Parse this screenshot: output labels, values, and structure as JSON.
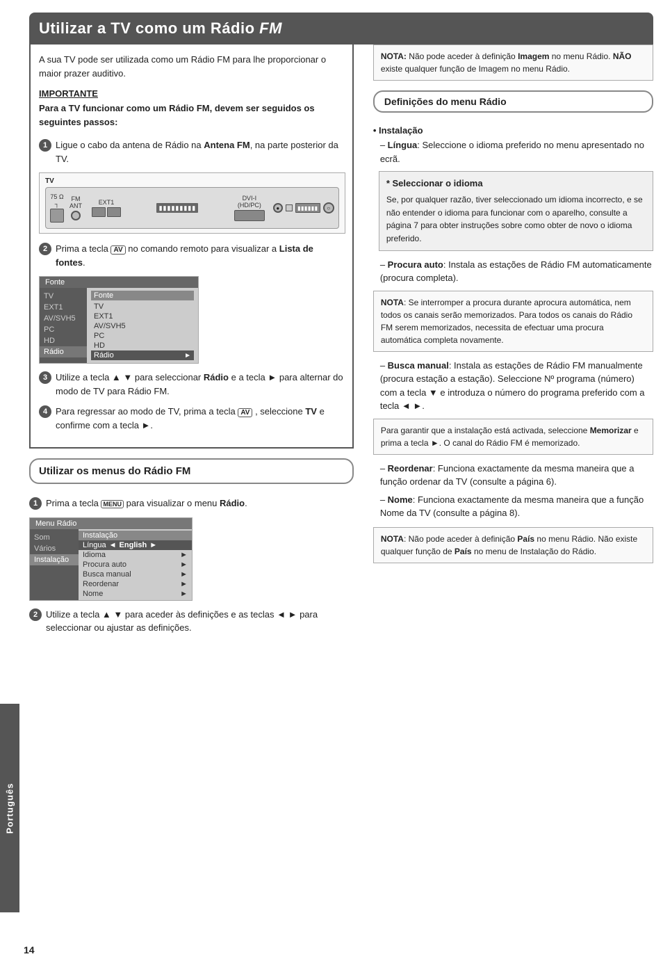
{
  "page": {
    "number": "14",
    "sidebar_label": "Português"
  },
  "title": {
    "prefix": "Utilizar a TV como um Rádio ",
    "highlight": "FM"
  },
  "intro": "A sua TV pode ser utilizada como um Rádio FM para lhe proporcionar o maior prazer auditivo.",
  "importante": {
    "label": "IMPORTANTE",
    "body": "Para a TV funcionar como um Rádio FM, devem ser seguidos os seguintes passos:"
  },
  "steps_left": [
    {
      "number": "1",
      "text": "Ligue o cabo da antena de Rádio na ",
      "bold": "Antena FM",
      "suffix": ", na parte posterior da TV."
    },
    {
      "number": "2",
      "text": "Prima a tecla ",
      "av_symbol": "AV",
      "suffix": " no comando remoto para visualizar a ",
      "bold2": "Lista de fontes",
      "end": "."
    },
    {
      "number": "3",
      "text": "Utilize a tecla ▲ ▼ para seleccionar ",
      "bold": "Rádio",
      "suffix": " e a tecla ► para alternar do modo de TV para Rádio FM."
    },
    {
      "number": "4",
      "text": "Para regressar ao modo de TV, prima a tecla ",
      "av_symbol": "AV",
      "suffix": " , seleccione ",
      "bold2": "TV",
      "end": " e confirme com a tecla ►."
    }
  ],
  "tv_diagram": {
    "label": "TV",
    "ports": [
      {
        "label": "75 Ω\n┐",
        "type": "square_small"
      },
      {
        "label": "FM\nANT",
        "type": "circle"
      },
      {
        "label": "EXT1\n⬜⬜",
        "type": "square"
      },
      {
        "label": "DVI-I\n(HD/PC)",
        "type": "wide"
      }
    ]
  },
  "source_menu": {
    "header": "Fonte",
    "left_items": [
      "TV",
      "EXT1",
      "AV/SVH5",
      "PC",
      "HD",
      "Rádio"
    ],
    "right_header": "Fonte",
    "right_items": [
      "TV",
      "EXT1",
      "AV/SVH5",
      "PC",
      "HD",
      "Rádio"
    ],
    "highlighted": "Rádio"
  },
  "radio_menu_section": {
    "title": "Utilizar os menus do Rádio FM",
    "step1": {
      "number": "1",
      "text": "Prima a tecla ",
      "menu_symbol": "MENU",
      "suffix": " para visualizar o menu ",
      "bold": "Rádio",
      "end": "."
    },
    "step2": {
      "number": "2",
      "text": "Utilize a tecla ▲ ▼ para aceder às definições e as teclas ◄ ► para seleccionar ou ajustar as definições."
    },
    "radio_menu": {
      "header": "Menu Rádio",
      "left_items": [
        "Som",
        "Vários",
        "Instalação"
      ],
      "sub_header": "Instalação",
      "sub_items": [
        {
          "label": "Língua",
          "value": "English",
          "arrow_left": "◄",
          "arrow_right": "►"
        },
        {
          "label": "Idioma",
          "arrow": "►"
        },
        {
          "label": "Procura auto",
          "arrow": "►"
        },
        {
          "label": "Busca manual",
          "arrow": "►"
        },
        {
          "label": "Reordenar",
          "arrow": "►"
        },
        {
          "label": "Nome",
          "arrow": "►"
        }
      ]
    }
  },
  "right_column": {
    "nota1": {
      "bold_label": "NOTA:",
      "text": " Não pode aceder à definição ",
      "bold_word": "Imagem",
      "suffix": " no menu Rádio. ",
      "bold_nao": "NÃO",
      "rest": " existe qualquer função de Imagem no menu Rádio."
    },
    "definitions": {
      "title": "Definições do menu Rádio",
      "installation": {
        "label": "• Instalação",
        "lingua": {
          "dash": "– ",
          "bold": "Língua",
          "text": ": Seleccione o idioma preferido no menu apresentado no ecrã."
        }
      },
      "sel_idioma": {
        "title": "* Seleccionar o idioma",
        "text": "Se, por qualquer razão, tiver seleccionado um idioma incorrecto, e se não entender o idioma para funcionar com o aparelho, consulte a página 7 para obter instruções sobre como obter de novo o idioma preferido."
      },
      "procura_auto": {
        "dash": "– ",
        "bold": "Procura auto",
        "text": ": Instala as estações de Rádio FM automaticamente (procura completa)."
      },
      "nota2": {
        "bold_label": "NOTA",
        "text": ": Se interromper a procura durante aprocura automática, nem todos os canais serão memorizados. Para todos os canais do Rádio FM serem memorizados, necessita de efectuar uma procura automática completa novamente."
      },
      "busca_manual": {
        "dash": "– ",
        "bold": "Busca manual",
        "text": ": Instala as estações de Rádio FM manualmente (procura estação a estação). Seleccione Nº programa (número) com a tecla ▼ e introduza o número do programa preferido com a tecla ◄ ►."
      },
      "guarantee_box": {
        "text": "Para garantir que a instalação está activada, seleccione ",
        "bold": "Memorizar",
        "suffix": " e prima a tecla ►. O canal do Rádio FM é memorizado."
      },
      "reordenar": {
        "dash": "– ",
        "bold": "Reordenar",
        "text": ": Funciona exactamente da mesma maneira que a função ordenar da TV (consulte a página 6)."
      },
      "nome": {
        "dash": "– ",
        "bold": "Nome",
        "text": ": Funciona exactamente da mesma maneira que a função Nome da TV (consulte a página 8)."
      },
      "nota3": {
        "bold_label": "NOTA",
        "text": ": Não pode aceder à definição ",
        "bold_pais": "País",
        "rest": " no menu Rádio. Não existe qualquer função de ",
        "bold_pais2": "País",
        "end": " no menu de Instalação do Rádio."
      }
    }
  }
}
